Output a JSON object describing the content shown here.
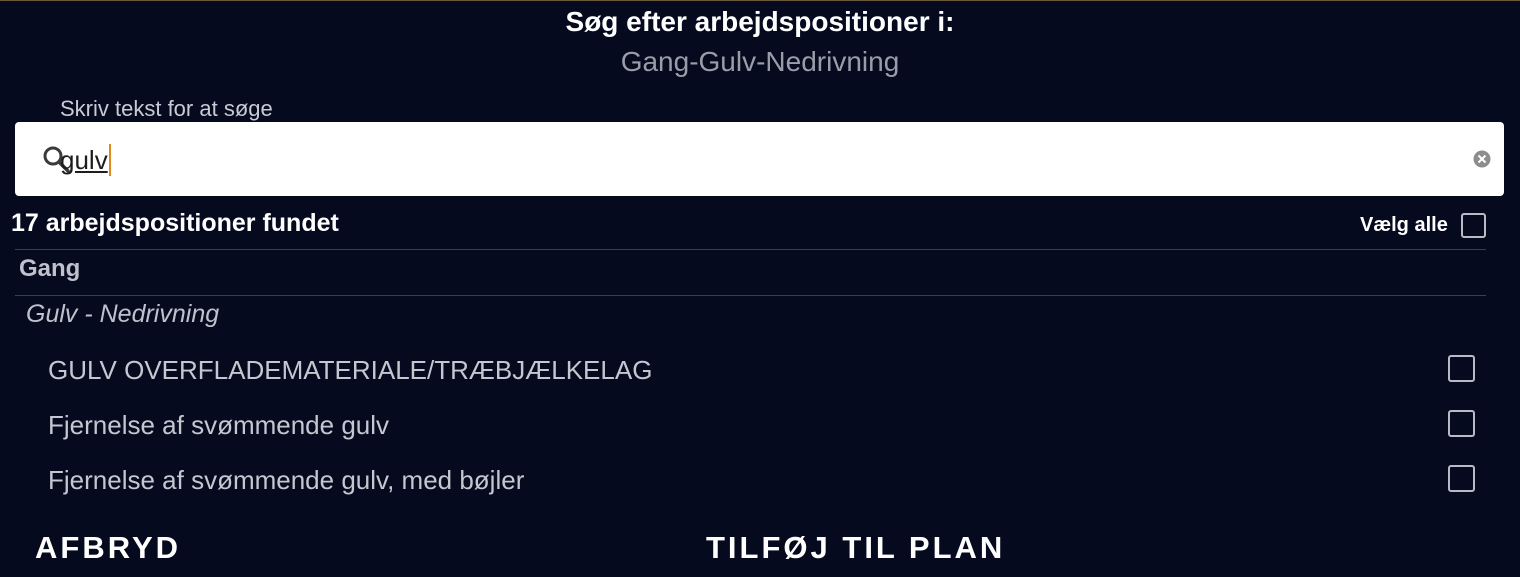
{
  "dialog": {
    "title": "Søg efter arbejdspositioner i:",
    "subtitle": "Gang-Gulv-Nedrivning"
  },
  "search": {
    "label": "Skriv tekst for at søge",
    "value": "gulv",
    "search_icon": "search-icon",
    "clear_icon": "clear-icon"
  },
  "results": {
    "count_text": "17 arbejdspositioner fundet",
    "select_all_label": "Vælg alle",
    "group": "Gang",
    "subgroup": "Gulv - Nedrivning",
    "items": [
      {
        "label": "GULV OVERFLADEMATERIALE/TRÆBJÆLKELAG",
        "checked": false
      },
      {
        "label": "Fjernelse af svømmende gulv",
        "checked": false
      },
      {
        "label": "Fjernelse af svømmende gulv, med bøjler",
        "checked": false
      }
    ]
  },
  "actions": {
    "cancel_label": "AFBRYD",
    "add_label": "TILFØJ TIL PLAN"
  },
  "colors": {
    "background": "#060a1f",
    "caret": "#e08a1a"
  }
}
